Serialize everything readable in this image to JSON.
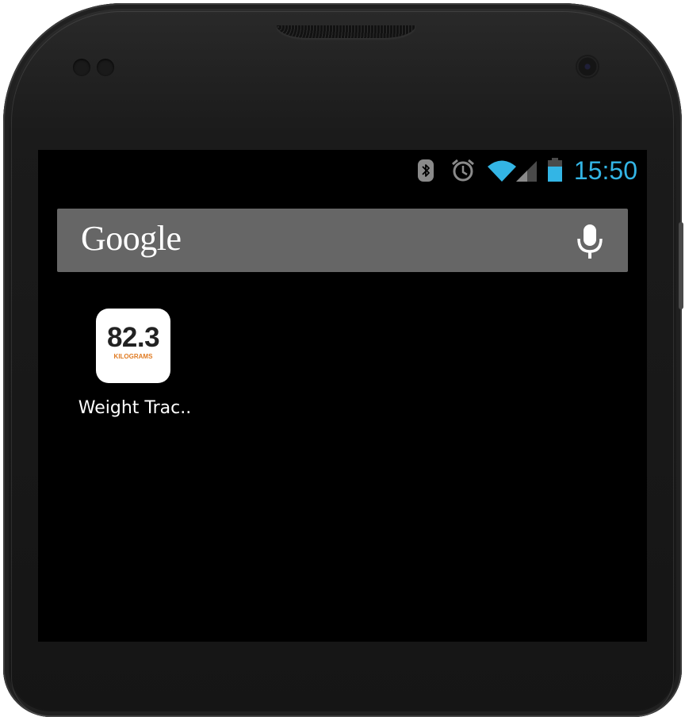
{
  "status_bar": {
    "time": "15:50",
    "icons": [
      "bluetooth-icon",
      "alarm-icon",
      "wifi-icon",
      "signal-icon",
      "battery-icon"
    ],
    "accent_color": "#33b5e5",
    "battery_level": 0.65
  },
  "search": {
    "logo_text": "Google",
    "mic_icon": "mic-icon",
    "background": "#666666"
  },
  "apps": [
    {
      "icon_value": "82.3",
      "icon_unit": "KILOGRAMS",
      "label": "Weight Trac..",
      "unit_color": "#e07b22"
    }
  ]
}
